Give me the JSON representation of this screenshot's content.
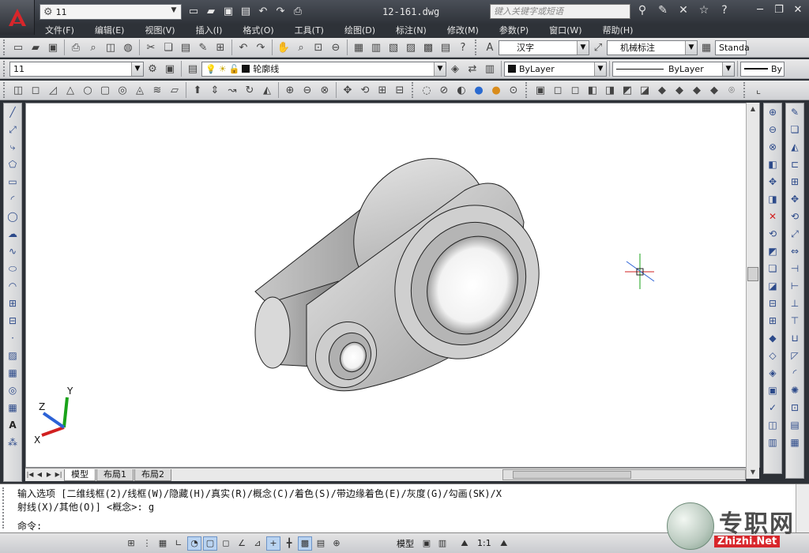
{
  "title_bar": {
    "workspace": "11",
    "document_title": "12-161.dwg",
    "search_placeholder": "键入关键字或短语"
  },
  "menu": [
    "文件(F)",
    "编辑(E)",
    "视图(V)",
    "插入(I)",
    "格式(O)",
    "工具(T)",
    "绘图(D)",
    "标注(N)",
    "修改(M)",
    "参数(P)",
    "窗口(W)",
    "帮助(H)"
  ],
  "styles": {
    "text_style": "汉字",
    "dim_style": "机械标注",
    "table_style": "Standa"
  },
  "layers": {
    "layer_state": "11",
    "current_layer": "轮廓线"
  },
  "properties": {
    "color": "ByLayer",
    "linetype": "ByLayer",
    "lineweight": "By"
  },
  "layout_tabs": [
    "模型",
    "布局1",
    "布局2"
  ],
  "command": {
    "line1": "输入选项 [二维线框(2)/线框(W)/隐藏(H)/真实(R)/概念(C)/着色(S)/带边缘着色(E)/灰度(G)/勾画(SK)/X",
    "line2": "射线(X)/其他(O)] <概念>: g",
    "prompt": "命令:"
  },
  "status_bar": {
    "space": "模型",
    "annotation_scale": "1:1"
  },
  "ucs": {
    "x": "X",
    "y": "Y",
    "z": "Z"
  },
  "watermark": {
    "text": "专职网",
    "url": "Zhizhi.Net"
  },
  "colors": {
    "title_bg": "#2f333a",
    "toolbar_bg": "#d8dadd",
    "viewport_bg": "#ffffff",
    "axis_x": "#d12020",
    "axis_y": "#1aa31a",
    "axis_z": "#2c62d6"
  }
}
